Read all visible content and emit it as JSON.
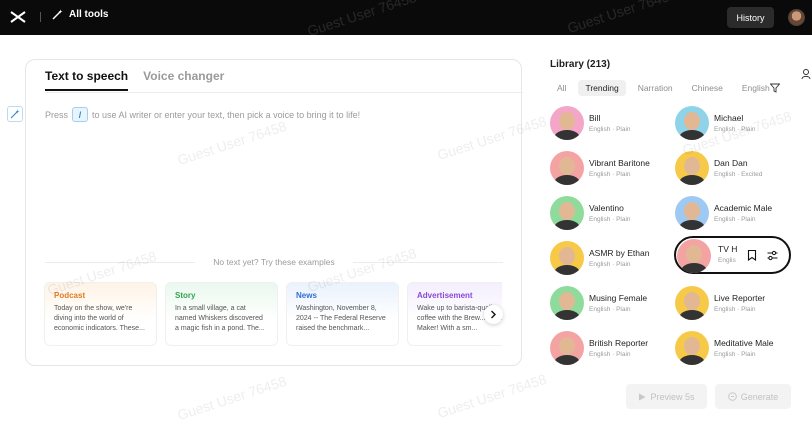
{
  "topbar": {
    "all_tools_label": "All tools",
    "history_label": "History"
  },
  "editor": {
    "tabs": [
      {
        "label": "Text to speech",
        "active": true
      },
      {
        "label": "Voice changer",
        "active": false
      }
    ],
    "hint_before": "Press",
    "hint_key": "/",
    "hint_after": "to use AI writer or enter your text, then pick a voice to bring it to life!",
    "examples_title": "No text yet? Try these examples",
    "examples": [
      {
        "title": "Podcast",
        "text": "Today on the show, we're diving into the world of economic indicators. These..."
      },
      {
        "title": "Story",
        "text": "In a small village, a cat named Whiskers discovered a magic fish in a pond. The..."
      },
      {
        "title": "News",
        "text": "Washington, November 8, 2024 -- The Federal Reserve raised the benchmark..."
      },
      {
        "title": "Advertisement",
        "text": "Wake up to barista-quality coffee with the Brew... Coffee Maker! With a sm..."
      }
    ]
  },
  "library": {
    "title": "Library (213)",
    "filters": [
      "All",
      "Trending",
      "Narration",
      "Chinese",
      "English"
    ],
    "active_filter": "Trending",
    "voices": [
      {
        "name": "Bill",
        "meta": "English · Plain",
        "color": "#f3a6c8"
      },
      {
        "name": "Michael",
        "meta": "English · Plain",
        "color": "#8fd3e8"
      },
      {
        "name": "Vibrant Baritone",
        "meta": "English · Plain",
        "color": "#f4a3a3"
      },
      {
        "name": "Dan Dan",
        "meta": "English · Excited",
        "color": "#f7c948"
      },
      {
        "name": "Valentino",
        "meta": "English · Plain",
        "color": "#8edb9c"
      },
      {
        "name": "Academic Male",
        "meta": "English · Plain",
        "color": "#9ec9f2"
      },
      {
        "name": "ASMR by Ethan",
        "meta": "English · Plain",
        "color": "#f7c948"
      },
      {
        "name": "TV H",
        "meta": "Englis",
        "color": "#f4a3a3"
      },
      {
        "name": "Musing Female",
        "meta": "English · Plain",
        "color": "#8edb9c"
      },
      {
        "name": "Live Reporter",
        "meta": "English · Plain",
        "color": "#f7c948"
      },
      {
        "name": "British Reporter",
        "meta": "English · Plain",
        "color": "#f4a3a3"
      },
      {
        "name": "Meditative Male",
        "meta": "English · Plain",
        "color": "#f7c948"
      }
    ]
  },
  "actions": {
    "preview_label": "Preview 5s",
    "generate_label": "Generate"
  }
}
